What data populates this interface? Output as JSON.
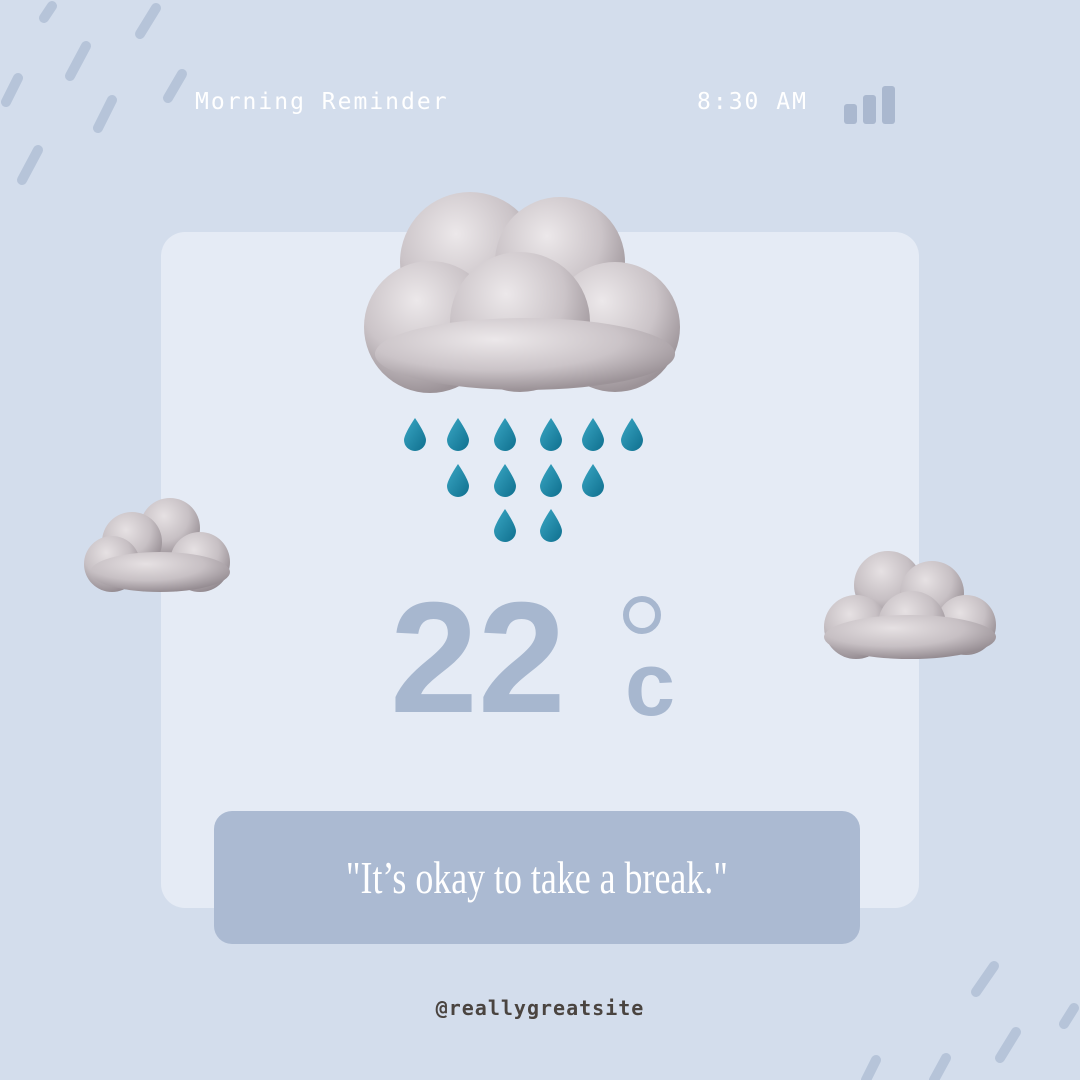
{
  "header": {
    "title": "Morning Reminder",
    "time": "8:30 AM",
    "signal_icon": "signal-bars-icon"
  },
  "weather": {
    "icon": "rain-cloud-icon",
    "temperature": "22",
    "unit": "c"
  },
  "quote": "\"It’s okay to take a break.\"",
  "handle": "@reallygreatsite",
  "colors": {
    "background": "#d3ddec",
    "card": "#e5ebf5",
    "accent": "#a7b7cf",
    "quote_box": "#abbad2",
    "raindrop": "#1f8aa8",
    "cloud": "#c9c3c6"
  }
}
